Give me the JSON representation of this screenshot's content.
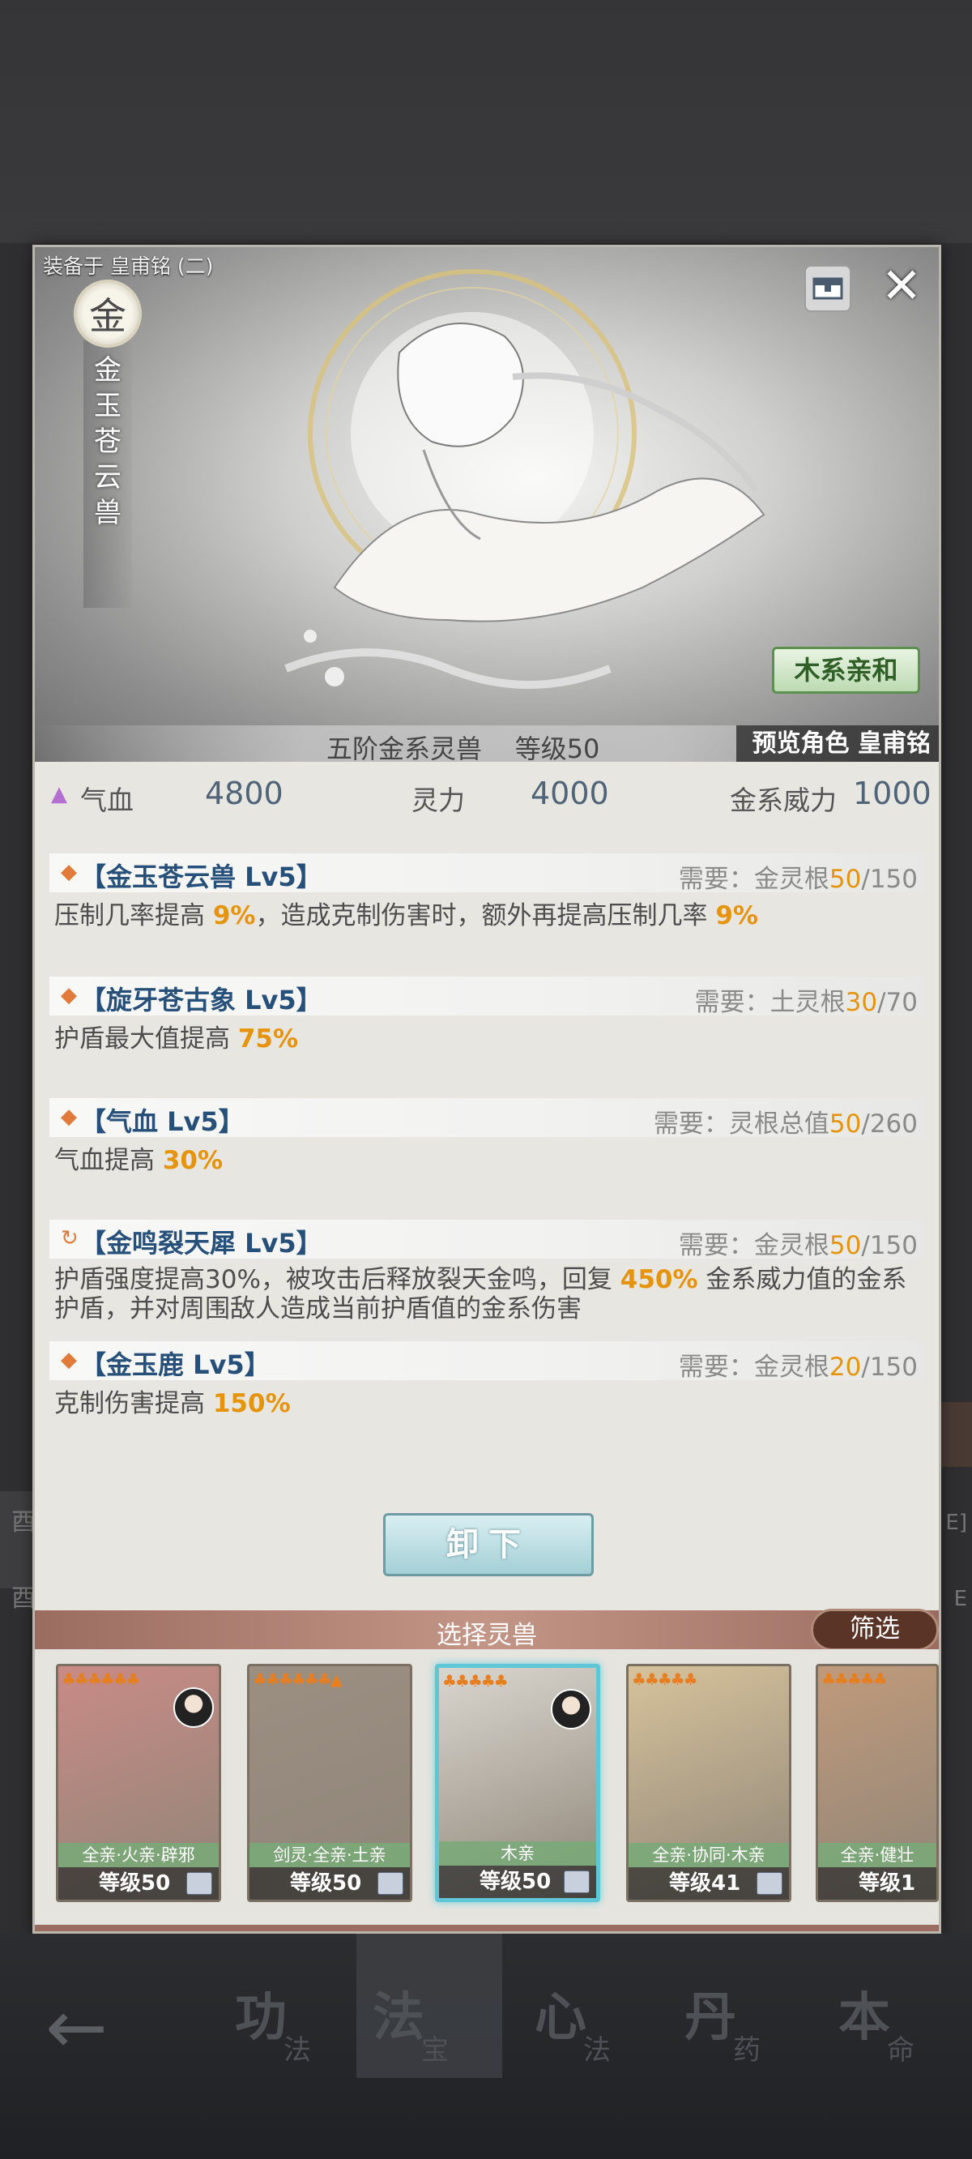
{
  "hero": {
    "equipped_label": "装备于 皇甫铭 (二)",
    "element_char": "金",
    "beast_name": "金玉苍云兽",
    "affinity": "木系亲和",
    "summary": "五阶金系灵兽    等级50",
    "preview_label": "预览角色 皇甫铭"
  },
  "stats": [
    {
      "label": "气血",
      "value": "4800"
    },
    {
      "label": "灵力",
      "value": "4000"
    },
    {
      "label": "金系威力",
      "value": "1000"
    }
  ],
  "skills": [
    {
      "title": "【金玉苍云兽 Lv5】",
      "req_label": "需要：金灵根",
      "req_have": "50",
      "req_total": "/150",
      "desc": [
        {
          "t": "压制几率提高 "
        },
        {
          "h": "9%"
        },
        {
          "t": "，造成克制伤害时，额外再提高压制几率 "
        },
        {
          "h": "9%"
        }
      ]
    },
    {
      "title": "【旋牙苍古象 Lv5】",
      "req_label": "需要：土灵根",
      "req_have": "30",
      "req_total": "/70",
      "desc": [
        {
          "t": "护盾最大值提高 "
        },
        {
          "h": "75%"
        }
      ]
    },
    {
      "title": "【气血 Lv5】",
      "req_label": "需要：灵根总值",
      "req_have": "50",
      "req_total": "/260",
      "desc": [
        {
          "t": "气血提高 "
        },
        {
          "h": "30%"
        }
      ]
    },
    {
      "title": "【金鸣裂天犀 Lv5】",
      "req_label": "需要：金灵根",
      "req_have": "50",
      "req_total": "/150",
      "desc": [
        {
          "t": "护盾强度提高30%，被攻击后释放裂天金鸣，回复 "
        },
        {
          "h": "450%"
        },
        {
          "t": " 金系威力值的金系护盾，并对周围敌人造成当前护盾值的金系伤害"
        }
      ]
    },
    {
      "title": "【金玉鹿 Lv5】",
      "req_label": "需要：金灵根",
      "req_have": "20",
      "req_total": "/150",
      "desc": [
        {
          "t": "克制伤害提高 "
        },
        {
          "h": "150%"
        }
      ]
    }
  ],
  "unequip_label": "卸下",
  "select_title": "选择灵兽",
  "filter_label": "筛选",
  "cards": [
    {
      "tags": "全亲·火亲·辟邪",
      "level": "等级50",
      "color": "#c98b86"
    },
    {
      "tags": "剑灵·全亲·土亲",
      "level": "等级50",
      "color": "#9b8f82"
    },
    {
      "tags": "木亲",
      "level": "等级50",
      "color": "#d9d6cf"
    },
    {
      "tags": "全亲·协同·木亲",
      "level": "等级41",
      "color": "#d6c29b"
    },
    {
      "tags": "全亲·健壮",
      "level": "等级1",
      "color": "#c09a7b"
    }
  ],
  "nav": [
    {
      "big": "功",
      "small": "法"
    },
    {
      "big": "法",
      "small": "宝"
    },
    {
      "big": "心",
      "small": "法"
    },
    {
      "big": "丹",
      "small": "药"
    },
    {
      "big": "本",
      "small": "命"
    }
  ],
  "background_rows": {
    "row1": "酉",
    "row2": "酉",
    "row1_right": "E]",
    "row2_right": "E"
  }
}
